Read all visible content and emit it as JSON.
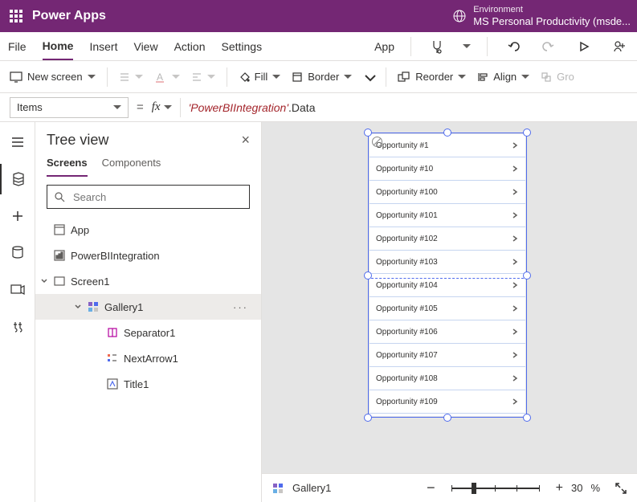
{
  "header": {
    "app_title": "Power Apps",
    "app_button": "App",
    "env_label": "Environment",
    "env_name": "MS Personal Productivity (msde..."
  },
  "menu": {
    "file": "File",
    "home": "Home",
    "insert": "Insert",
    "view": "View",
    "action": "Action",
    "settings": "Settings"
  },
  "ribbon": {
    "new_screen": "New screen",
    "fill": "Fill",
    "border": "Border",
    "reorder": "Reorder",
    "align": "Align",
    "group": "Gro"
  },
  "formula": {
    "property": "Items",
    "ref": "'PowerBIIntegration'",
    "prop": ".Data"
  },
  "tree": {
    "title": "Tree view",
    "tab_screens": "Screens",
    "tab_components": "Components",
    "search_placeholder": "Search",
    "nodes": {
      "app": "App",
      "pbi": "PowerBIIntegration",
      "screen1": "Screen1",
      "gallery1": "Gallery1",
      "separator1": "Separator1",
      "nextarrow1": "NextArrow1",
      "title1": "Title1"
    }
  },
  "gallery_items": [
    "Opportunity #1",
    "Opportunity #10",
    "Opportunity #100",
    "Opportunity #101",
    "Opportunity #102",
    "Opportunity #103",
    "Opportunity #104",
    "Opportunity #105",
    "Opportunity #106",
    "Opportunity #107",
    "Opportunity #108",
    "Opportunity #109"
  ],
  "status": {
    "selection": "Gallery1",
    "zoom": "30",
    "zoom_unit": "%"
  }
}
